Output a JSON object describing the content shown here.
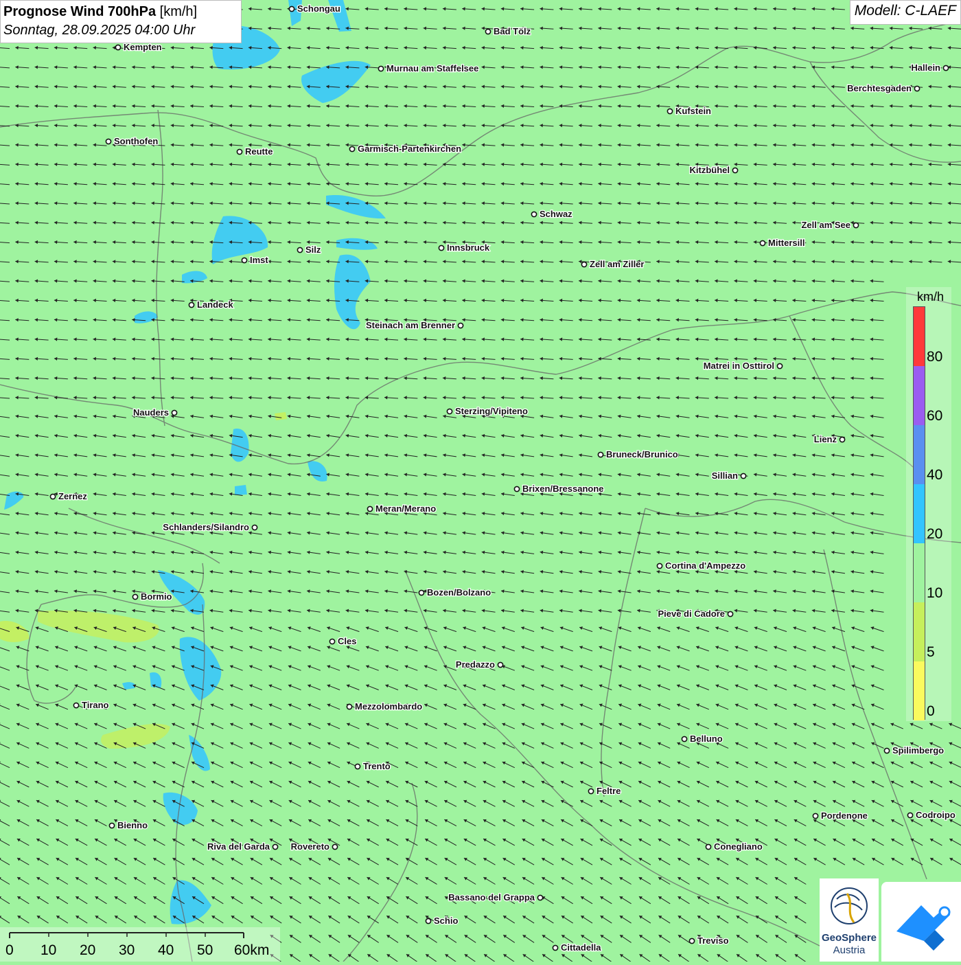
{
  "title": {
    "main": "Prognose Wind 700hPa",
    "unit": "[km/h]",
    "datetime": "Sonntag, 28.09.2025 04:00 Uhr"
  },
  "model": "Modell: C-LAEF",
  "legend": {
    "unit": "km/h",
    "labels": [
      "80",
      "60",
      "40",
      "20",
      "10",
      "5",
      "0"
    ],
    "colors": [
      "#ff3a3a",
      "#9a5df0",
      "#5a8ff0",
      "#33c4ff",
      "#9ff39f",
      "#c6ef5c",
      "#fafa5e"
    ]
  },
  "scalebar": {
    "labels": [
      "0",
      "10",
      "20",
      "30",
      "40",
      "50",
      "60km"
    ]
  },
  "logos": {
    "geosphere_line1": "GeoSphere",
    "geosphere_line2": "Austria"
  },
  "cities": [
    {
      "name": "Schongau"
    },
    {
      "name": "Bad Tölz"
    },
    {
      "name": "Kempten"
    },
    {
      "name": "Murnau am Staffelsee"
    },
    {
      "name": "Hallein"
    },
    {
      "name": "Berchtesgaden"
    },
    {
      "name": "Kufstein"
    },
    {
      "name": "Sonthofen"
    },
    {
      "name": "Reutte"
    },
    {
      "name": "Garmisch-Partenkirchen"
    },
    {
      "name": "Kitzbühel"
    },
    {
      "name": "Schwaz"
    },
    {
      "name": "Zell am See"
    },
    {
      "name": "Mittersill"
    },
    {
      "name": "Silz"
    },
    {
      "name": "Innsbruck"
    },
    {
      "name": "Imst"
    },
    {
      "name": "Zell am Ziller"
    },
    {
      "name": "Landeck"
    },
    {
      "name": "Steinach am Brenner"
    },
    {
      "name": "Matrei in Osttirol"
    },
    {
      "name": "Nauders"
    },
    {
      "name": "Sterzing/Vipiteno"
    },
    {
      "name": "Lienz"
    },
    {
      "name": "Bruneck/Brunico"
    },
    {
      "name": "Sillian"
    },
    {
      "name": "Brixen/Bressanone"
    },
    {
      "name": "Zernez"
    },
    {
      "name": "Meran/Merano"
    },
    {
      "name": "Schlanders/Silandro"
    },
    {
      "name": "Cortina d'Ampezzo"
    },
    {
      "name": "Bozen/Bolzano"
    },
    {
      "name": "Bormio"
    },
    {
      "name": "Pieve di Cadore"
    },
    {
      "name": "Cles"
    },
    {
      "name": "Predazzo"
    },
    {
      "name": "Tirano"
    },
    {
      "name": "Mezzolombardo"
    },
    {
      "name": "Belluno"
    },
    {
      "name": "Spilimbergo"
    },
    {
      "name": "Trento"
    },
    {
      "name": "Feltre"
    },
    {
      "name": "Pordenone"
    },
    {
      "name": "Codroipo"
    },
    {
      "name": "Bienno"
    },
    {
      "name": "Riva del Garda"
    },
    {
      "name": "Rovereto"
    },
    {
      "name": "Conegliano"
    },
    {
      "name": "Bassano del Grappa"
    },
    {
      "name": "Schio"
    },
    {
      "name": "Treviso"
    },
    {
      "name": "Cittadella"
    }
  ]
}
